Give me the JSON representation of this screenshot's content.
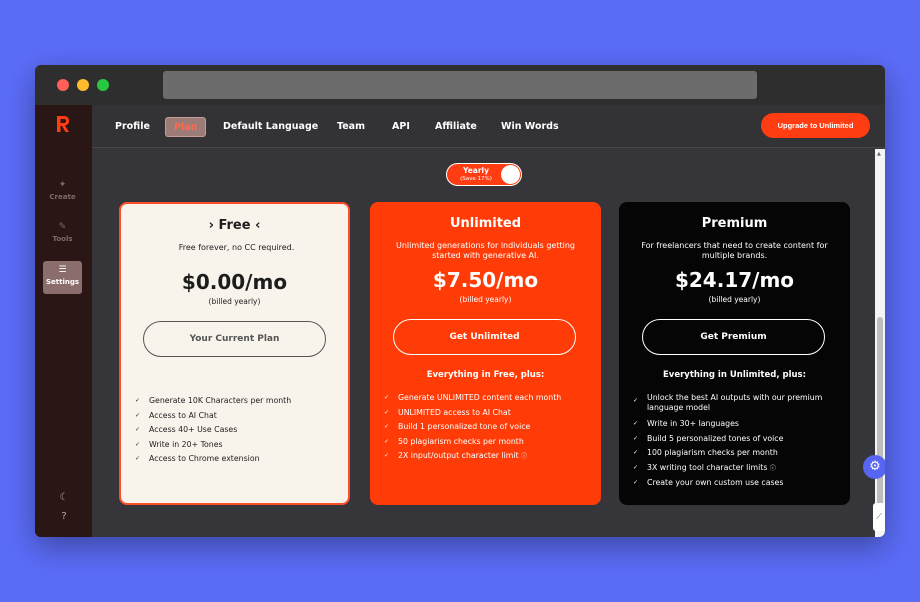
{
  "app": {
    "logo_letter": "R",
    "accent_color": "#ff3c12"
  },
  "sidebar": {
    "items": [
      {
        "label": "Create",
        "icon": "sparkle-icon"
      },
      {
        "label": "Tools",
        "icon": "wrench-icon"
      },
      {
        "label": "Settings",
        "icon": "sliders-icon",
        "active": true
      }
    ],
    "bottom_icons": [
      "moon-icon",
      "help-icon"
    ]
  },
  "navbar": {
    "tabs": [
      {
        "label": "Profile"
      },
      {
        "label": "Plan",
        "active": true
      },
      {
        "label": "Default Language"
      },
      {
        "label": "Team"
      },
      {
        "label": "API"
      },
      {
        "label": "Affiliate"
      },
      {
        "label": "Win Words"
      }
    ],
    "upgrade_label": "Upgrade to Unlimited"
  },
  "billing_toggle": {
    "label": "Yearly",
    "sublabel": "(Save 17%)",
    "on": true
  },
  "plans": [
    {
      "name": "Free",
      "description": "Free forever, no CC required.",
      "price": "$0.00/mo",
      "billing": "(billed yearly)",
      "button": "Your Current Plan",
      "features_title": "",
      "features": [
        "Generate 10K Characters per month",
        "Access to AI Chat",
        "Access 40+ Use Cases",
        "Write in 20+ Tones",
        "Access to Chrome extension"
      ]
    },
    {
      "name": "Unlimited",
      "description": "Unlimited generations for individuals getting started with generative AI.",
      "price": "$7.50/mo",
      "billing": "(billed yearly)",
      "button": "Get Unlimited",
      "features_title": "Everything in Free, plus:",
      "features": [
        "Generate UNLIMITED content each month",
        "UNLIMITED access to AI Chat",
        "Build 1 personalized tone of voice",
        "50 plagiarism checks per month",
        "2X input/output character limit"
      ]
    },
    {
      "name": "Premium",
      "description": "For freelancers that need to create content for multiple brands.",
      "price": "$24.17/mo",
      "billing": "(billed yearly)",
      "button": "Get Premium",
      "features_title": "Everything in Unlimited, plus:",
      "features": [
        "Unlock the best AI outputs with our premium language model",
        "Write in 30+ languages",
        "Build 5 personalized tones of voice",
        "100 plagiarism checks per month",
        "3X writing tool character limits",
        "Create your own custom use cases"
      ]
    }
  ]
}
